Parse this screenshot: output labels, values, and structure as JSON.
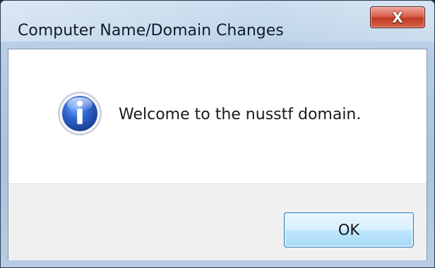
{
  "window": {
    "title": "Computer Name/Domain Changes",
    "close_glyph": "X"
  },
  "dialog": {
    "icon": "information-icon",
    "message": "Welcome to the nusstf domain.",
    "ok_label": "OK"
  },
  "colors": {
    "icon_blue": "#2a5bbf",
    "button_border": "#3c7fb1",
    "close_red": "#c03a23"
  }
}
